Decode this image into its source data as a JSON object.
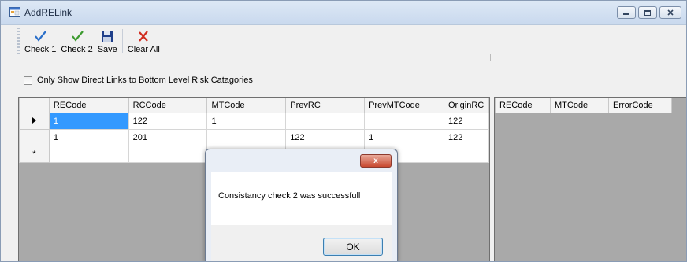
{
  "window": {
    "title": "AddRELink"
  },
  "toolbar": {
    "check1_label": "Check 1",
    "check2_label": "Check 2",
    "save_label": "Save",
    "clear_all_label": "Clear All"
  },
  "option": {
    "label": "Only Show Direct Links to Bottom Level Risk Catagories",
    "checked": false
  },
  "links_grid": {
    "columns": [
      "RECode",
      "RCCode",
      "MTCode",
      "PrevRC",
      "PrevMTCode",
      "OriginRC"
    ],
    "rows": [
      [
        "1",
        "122",
        "1",
        "",
        "",
        "122"
      ],
      [
        "1",
        "201",
        "",
        "122",
        "1",
        "122"
      ]
    ],
    "new_row_marker": "*"
  },
  "errors_grid": {
    "columns": [
      "RECode",
      "MTCode",
      "ErrorCode"
    ]
  },
  "dialog": {
    "close_glyph": "x",
    "message": "Consistancy check 2 was successfull",
    "ok_label": "OK"
  }
}
